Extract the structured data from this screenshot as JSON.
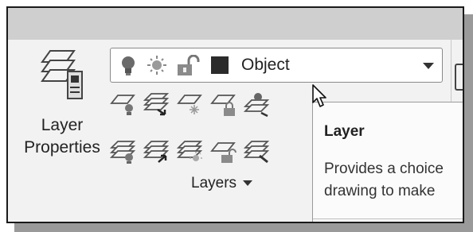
{
  "ribbon": {
    "layer_properties": {
      "line1": "Layer",
      "line2": "Properties"
    },
    "layer_dropdown": {
      "current_layer": "Object",
      "state_icons": [
        "lightbulb-icon",
        "sun-icon",
        "unlock-icon"
      ],
      "color_swatch": "#2b2b2b"
    },
    "small_tools_row1": [
      "layer-off-icon",
      "layer-isolate-icon",
      "layer-freeze-icon",
      "layer-lock-icon",
      "layer-match-icon"
    ],
    "small_tools_row2": [
      "layer-on-icon",
      "layer-unisolate-icon",
      "layer-thaw-icon",
      "layer-unlock-icon",
      "layer-change-icon"
    ],
    "panel_title": "Layers"
  },
  "tooltip": {
    "title": "Layer",
    "desc_line1": "Provides a choice",
    "desc_line2": "drawing to make"
  },
  "colors": {
    "panel_bg": "#f2f2f2",
    "top_band": "#cfcfcf",
    "frame": "#1a1a1a"
  }
}
